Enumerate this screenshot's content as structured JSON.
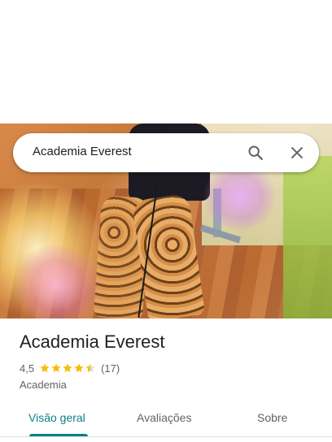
{
  "search": {
    "query": "Academia Everest",
    "search_icon": "search-icon",
    "close_icon": "close-icon"
  },
  "place": {
    "name": "Academia Everest",
    "rating": "4,5",
    "rating_value": 4.5,
    "stars_max": 5,
    "reviews": "(17)",
    "category": "Academia"
  },
  "tabs": [
    {
      "label": "Visão geral",
      "active": true
    },
    {
      "label": "Avaliações",
      "active": false
    },
    {
      "label": "Sobre",
      "active": false
    }
  ],
  "colors": {
    "accent": "#0b7f8a",
    "star": "#fbbc04",
    "text": "#202124",
    "secondary": "#5f6368"
  }
}
